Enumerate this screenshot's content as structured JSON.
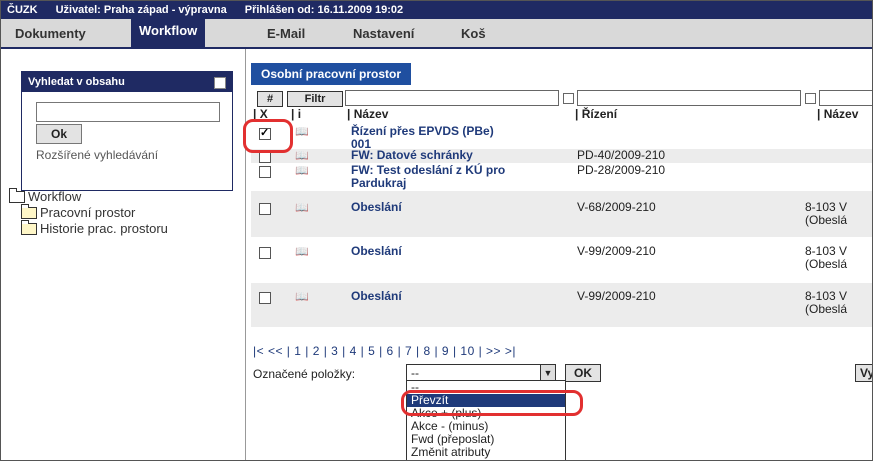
{
  "topbar": {
    "app": "ČUZK",
    "user": "Uživatel: Praha západ - výpravna",
    "login": "Přihlášen od: 16.11.2009 19:02"
  },
  "menu": {
    "items": [
      {
        "label": "Dokumenty"
      },
      {
        "label": "Workflow",
        "active": true
      },
      {
        "label": "E-Mail"
      },
      {
        "label": "Nastavení"
      },
      {
        "label": "Koš"
      }
    ]
  },
  "sidebar": {
    "search_title": "Vyhledat v obsahu",
    "search_value": "",
    "ok_label": "Ok",
    "advanced_link": "Rozšířené vyhledávání",
    "tree": {
      "root": "Workflow",
      "children": [
        "Pracovní prostor",
        "Historie prac. prostoru"
      ]
    }
  },
  "content": {
    "tab": "Osobní pracovní prostor",
    "hash_label": "#",
    "filter_label": "Filtr",
    "columns": {
      "x": "| X",
      "i": "| i",
      "nazev": "| Název",
      "rizeni": "| Řízení",
      "nazev2": "| Název"
    },
    "rows": [
      {
        "checked": true,
        "name": "Řízení přes EPVDS (PBe)",
        "name2": "001",
        "rizeni": "",
        "nazev2": "",
        "nazev2b": ""
      },
      {
        "checked": false,
        "name": "FW: Datové schránky",
        "name2": "",
        "rizeni": "PD-40/2009-210",
        "nazev2": "",
        "nazev2b": ""
      },
      {
        "checked": false,
        "name": "FW: Test odeslání z KÚ pro",
        "name2": "Pardukraj",
        "rizeni": "PD-28/2009-210",
        "nazev2": "",
        "nazev2b": ""
      },
      {
        "checked": false,
        "name": "Obeslání",
        "name2": "",
        "rizeni": "V-68/2009-210",
        "nazev2": "8-103 V",
        "nazev2b": "(Obeslá"
      },
      {
        "checked": false,
        "name": "Obeslání",
        "name2": "",
        "rizeni": "V-99/2009-210",
        "nazev2": "8-103 V",
        "nazev2b": "(Obeslá"
      },
      {
        "checked": false,
        "name": "Obeslání",
        "name2": "",
        "rizeni": "V-99/2009-210",
        "nazev2": "8-103 V",
        "nazev2b": "(Obeslá"
      }
    ],
    "pager": "|<  << | 1 | 2 | 3 | 4 | 5 | 6 | 7 | 8 | 9 | 10 |  >>  >|",
    "marked_label": "Označené položky:",
    "select_value": "--",
    "ok_label": "OK",
    "right_btn": "Vy",
    "dropdown_options": [
      {
        "label": "--",
        "selected": false
      },
      {
        "label": "Převzít",
        "selected": true
      },
      {
        "label": "Akce + (plus)",
        "selected": false
      },
      {
        "label": "Akce - (minus)",
        "selected": false
      },
      {
        "label": "Fwd (přeposlat)",
        "selected": false
      },
      {
        "label": "Změnit atributy",
        "selected": false
      }
    ]
  },
  "colors": {
    "navy": "#1f2a63",
    "tab_blue": "#1f4fa0",
    "highlight_red": "#e23030"
  }
}
